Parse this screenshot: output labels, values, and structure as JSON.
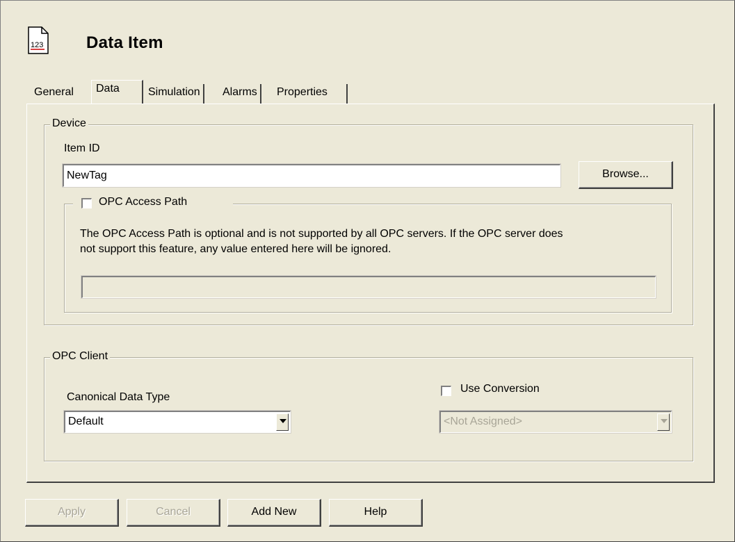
{
  "header": {
    "icon": "number-document-icon",
    "icon_text": "123",
    "title": "Data Item"
  },
  "tabs": [
    {
      "label": "General",
      "active": false
    },
    {
      "label": "Data",
      "active": true
    },
    {
      "label": "Simulation",
      "active": false
    },
    {
      "label": "Alarms",
      "active": false
    },
    {
      "label": "Properties",
      "active": false
    }
  ],
  "device": {
    "legend": "Device",
    "item_id_label": "Item ID",
    "item_id_value": "NewTag",
    "browse_label": "Browse...",
    "access_path": {
      "checkbox_label": "OPC Access Path",
      "checked": false,
      "description_line1": "The OPC Access Path is optional and is not supported by all OPC servers. If the OPC server does",
      "description_line2": "not support this feature, any value entered here will be ignored.",
      "value": ""
    }
  },
  "opc_client": {
    "legend": "OPC Client",
    "canonical_label": "Canonical Data Type",
    "canonical_value": "Default",
    "use_conversion_label": "Use Conversion",
    "use_conversion_checked": false,
    "conversion_value": "<Not Assigned>"
  },
  "buttons": {
    "apply": "Apply",
    "cancel": "Cancel",
    "add_new": "Add New",
    "help": "Help"
  }
}
